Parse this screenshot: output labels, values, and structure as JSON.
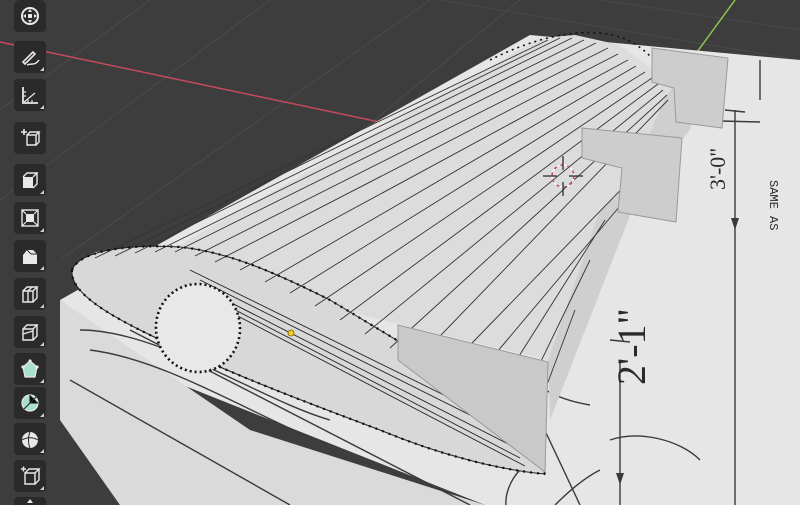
{
  "app": {
    "name": "3D viewport - wing modeling"
  },
  "blueprint": {
    "dimension_1": "2'-1\"",
    "dimension_2": "3'-0\"",
    "text_fragment": "SAME AS"
  },
  "colors": {
    "background": "#3d3d3d",
    "grid_line": "#4a4a4a",
    "x_axis": "#c84a5c",
    "y_axis": "#8bc34a",
    "toolbar_button": "#2a2a2a",
    "mesh_surface": "#d9d9d9",
    "selected_vertex": "#000000",
    "active_vertex": "#f5d020"
  },
  "toolbar": {
    "tools": [
      {
        "name": "transform",
        "icon": "transform-icon"
      },
      {
        "name": "annotate",
        "icon": "annotate-icon"
      },
      {
        "name": "measure",
        "icon": "measure-icon"
      },
      {
        "name": "add-cube",
        "icon": "add-cube-icon"
      },
      {
        "name": "extrude-region",
        "icon": "extrude-icon"
      },
      {
        "name": "inset-faces",
        "icon": "inset-icon"
      },
      {
        "name": "bevel",
        "icon": "bevel-icon"
      },
      {
        "name": "loop-cut",
        "icon": "loop-cut-icon"
      },
      {
        "name": "knife",
        "icon": "knife-icon"
      },
      {
        "name": "poly-build",
        "icon": "poly-build-icon"
      },
      {
        "name": "spin",
        "icon": "spin-icon"
      },
      {
        "name": "smooth",
        "icon": "smooth-icon"
      },
      {
        "name": "shear",
        "icon": "shear-icon"
      }
    ]
  }
}
